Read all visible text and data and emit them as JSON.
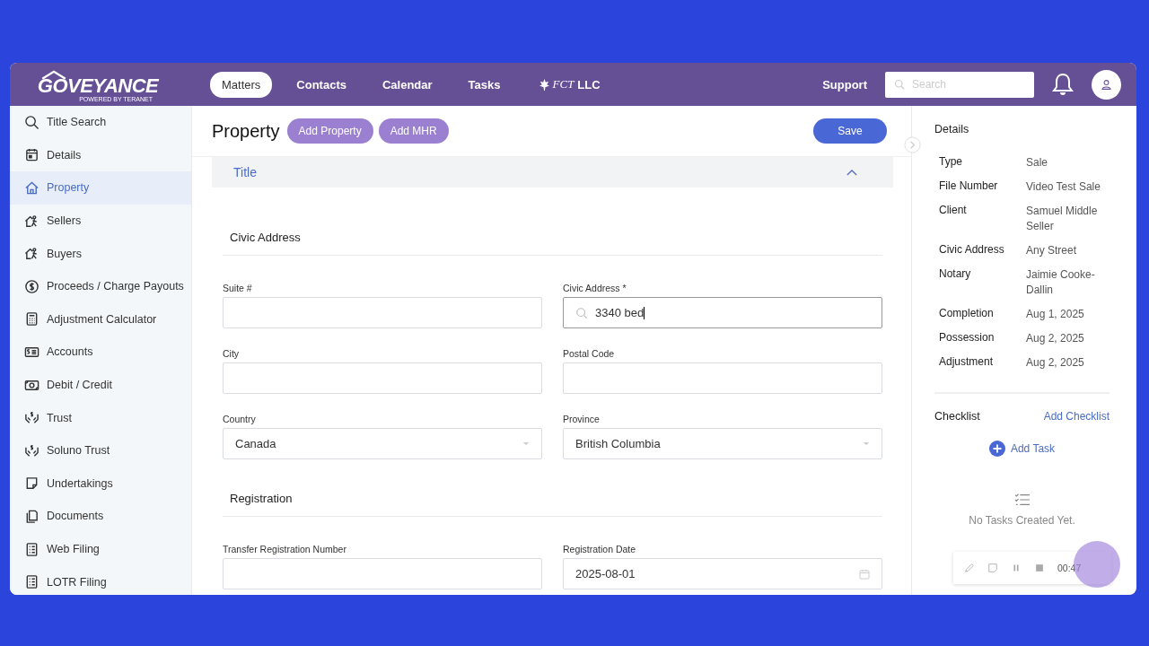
{
  "header": {
    "logo": "GOVEYANCE",
    "tagline": "POWERED BY TERANET",
    "nav": [
      {
        "label": "Matters",
        "selected": true
      },
      {
        "label": "Contacts",
        "selected": false
      },
      {
        "label": "Calendar",
        "selected": false
      },
      {
        "label": "Tasks",
        "selected": false
      }
    ],
    "org_logo": "FCT",
    "org": "LLC",
    "support": "Support",
    "search": {
      "placeholder": "Search"
    }
  },
  "sidebar": {
    "items": [
      {
        "label": "Title Search",
        "selected": false
      },
      {
        "label": "Details",
        "selected": false
      },
      {
        "label": "Property",
        "selected": true
      },
      {
        "label": "Sellers",
        "selected": false
      },
      {
        "label": "Buyers",
        "selected": false
      },
      {
        "label": "Proceeds / Charge Payouts",
        "selected": false
      },
      {
        "label": "Adjustment Calculator",
        "selected": false
      },
      {
        "label": "Accounts",
        "selected": false
      },
      {
        "label": "Debit / Credit",
        "selected": false
      },
      {
        "label": "Trust",
        "selected": false
      },
      {
        "label": "Soluno Trust",
        "selected": false
      },
      {
        "label": "Undertakings",
        "selected": false
      },
      {
        "label": "Documents",
        "selected": false
      },
      {
        "label": "Web Filing",
        "selected": false
      },
      {
        "label": "LOTR Filing",
        "selected": false
      }
    ]
  },
  "main": {
    "title": "Property",
    "actions": [
      "Add Property",
      "Add MHR"
    ],
    "save": "Save",
    "section": {
      "title": "Title",
      "expanded": true,
      "groups": [
        {
          "title": "Civic Address",
          "fields": [
            {
              "label": "Suite #",
              "kind": "text"
            },
            {
              "label": "Civic Address *",
              "kind": "search",
              "value": "3340 bed"
            },
            {
              "label": "City",
              "kind": "text"
            },
            {
              "label": "Postal Code",
              "kind": "text"
            },
            {
              "label": "Country",
              "kind": "select",
              "value": "Canada"
            },
            {
              "label": "Province",
              "kind": "select",
              "value": "British Columbia"
            }
          ]
        },
        {
          "title": "Registration",
          "fields": [
            {
              "label": "Transfer Registration Number",
              "kind": "text"
            },
            {
              "label": "Registration Date",
              "kind": "date",
              "value": "2025-08-01"
            }
          ]
        }
      ]
    }
  },
  "details": {
    "title": "Details",
    "rows": [
      {
        "label": "Type",
        "value": "Sale"
      },
      {
        "label": "File Number",
        "value": "Video Test Sale"
      },
      {
        "label": "Client",
        "value": "Samuel Middle Seller"
      },
      {
        "label": "Civic Address",
        "value": "Any Street"
      },
      {
        "label": "Notary",
        "value": "Jaimie Cooke-Dallin"
      },
      {
        "label": "Completion",
        "value": "Aug 1, 2025"
      },
      {
        "label": "Possession",
        "value": "Aug 2, 2025"
      },
      {
        "label": "Adjustment",
        "value": "Aug 2, 2025"
      }
    ],
    "checklist": {
      "title": "Checklist",
      "add_checklist": "Add Checklist",
      "add_task": "Add Task",
      "empty": "No Tasks Created Yet."
    }
  },
  "recorder": {
    "time": "00:47"
  }
}
